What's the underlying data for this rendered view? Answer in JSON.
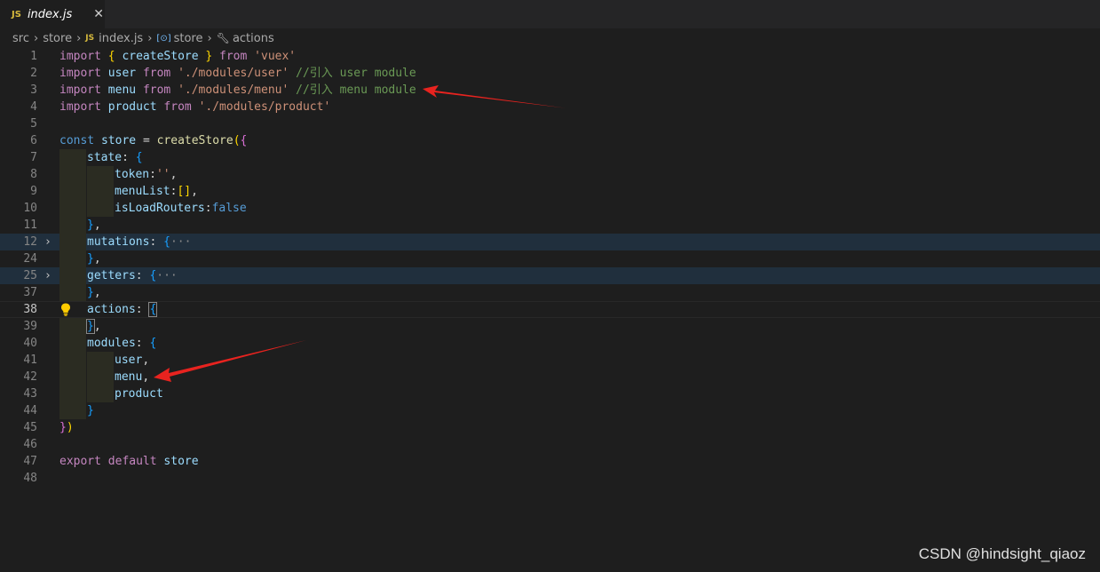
{
  "tab": {
    "badge": "JS",
    "filename": "index.js",
    "close": "✕"
  },
  "breadcrumb": {
    "src": "src",
    "store": "store",
    "file_badge": "JS",
    "file": "index.js",
    "object": "store",
    "symbol": "actions"
  },
  "lines": [
    {
      "n": "1"
    },
    {
      "n": "2"
    },
    {
      "n": "3"
    },
    {
      "n": "4"
    },
    {
      "n": "5"
    },
    {
      "n": "6"
    },
    {
      "n": "7"
    },
    {
      "n": "8"
    },
    {
      "n": "9"
    },
    {
      "n": "10"
    },
    {
      "n": "11"
    },
    {
      "n": "12"
    },
    {
      "n": "24"
    },
    {
      "n": "25"
    },
    {
      "n": "37"
    },
    {
      "n": "38"
    },
    {
      "n": "39"
    },
    {
      "n": "40"
    },
    {
      "n": "41"
    },
    {
      "n": "42"
    },
    {
      "n": "43"
    },
    {
      "n": "44"
    },
    {
      "n": "45"
    },
    {
      "n": "46"
    },
    {
      "n": "47"
    },
    {
      "n": "48"
    }
  ],
  "code": {
    "l1": [
      "import",
      "{",
      "createStore",
      "}",
      "from",
      "'vuex'"
    ],
    "l2": [
      "import",
      "user",
      "from",
      "'./modules/user'",
      "//引入 user module"
    ],
    "l3": [
      "import",
      "menu",
      "from",
      "'./modules/menu'",
      "//引入 menu module"
    ],
    "l4": [
      "import",
      "product",
      "from",
      "'./modules/product'"
    ],
    "l6": [
      "const",
      "store",
      "=",
      "createStore",
      "(",
      "{"
    ],
    "l7": [
      "state",
      ":",
      "{"
    ],
    "l8": [
      "token",
      ":",
      "''",
      ","
    ],
    "l9": [
      "menuList",
      ":",
      "[]",
      ","
    ],
    "l10": [
      "isLoadRouters",
      ":",
      "false"
    ],
    "l11": [
      "}",
      ","
    ],
    "l12": [
      "mutations",
      ":",
      "{",
      "···"
    ],
    "l24": [
      "}",
      ","
    ],
    "l25": [
      "getters",
      ":",
      "{",
      "···"
    ],
    "l37": [
      "}",
      ","
    ],
    "l38": [
      "actions",
      ":",
      "{"
    ],
    "l39": [
      "}",
      ","
    ],
    "l40": [
      "modules",
      ":",
      "{"
    ],
    "l41": [
      "user",
      ","
    ],
    "l42": [
      "menu",
      ","
    ],
    "l43": [
      "product"
    ],
    "l44": [
      "}"
    ],
    "l45": [
      "}",
      ")"
    ],
    "l47": [
      "export",
      "default",
      "store"
    ]
  },
  "watermark": "CSDN @hindsight_qiaoz",
  "colors": {
    "annotation_arrow": "#e8231f"
  }
}
